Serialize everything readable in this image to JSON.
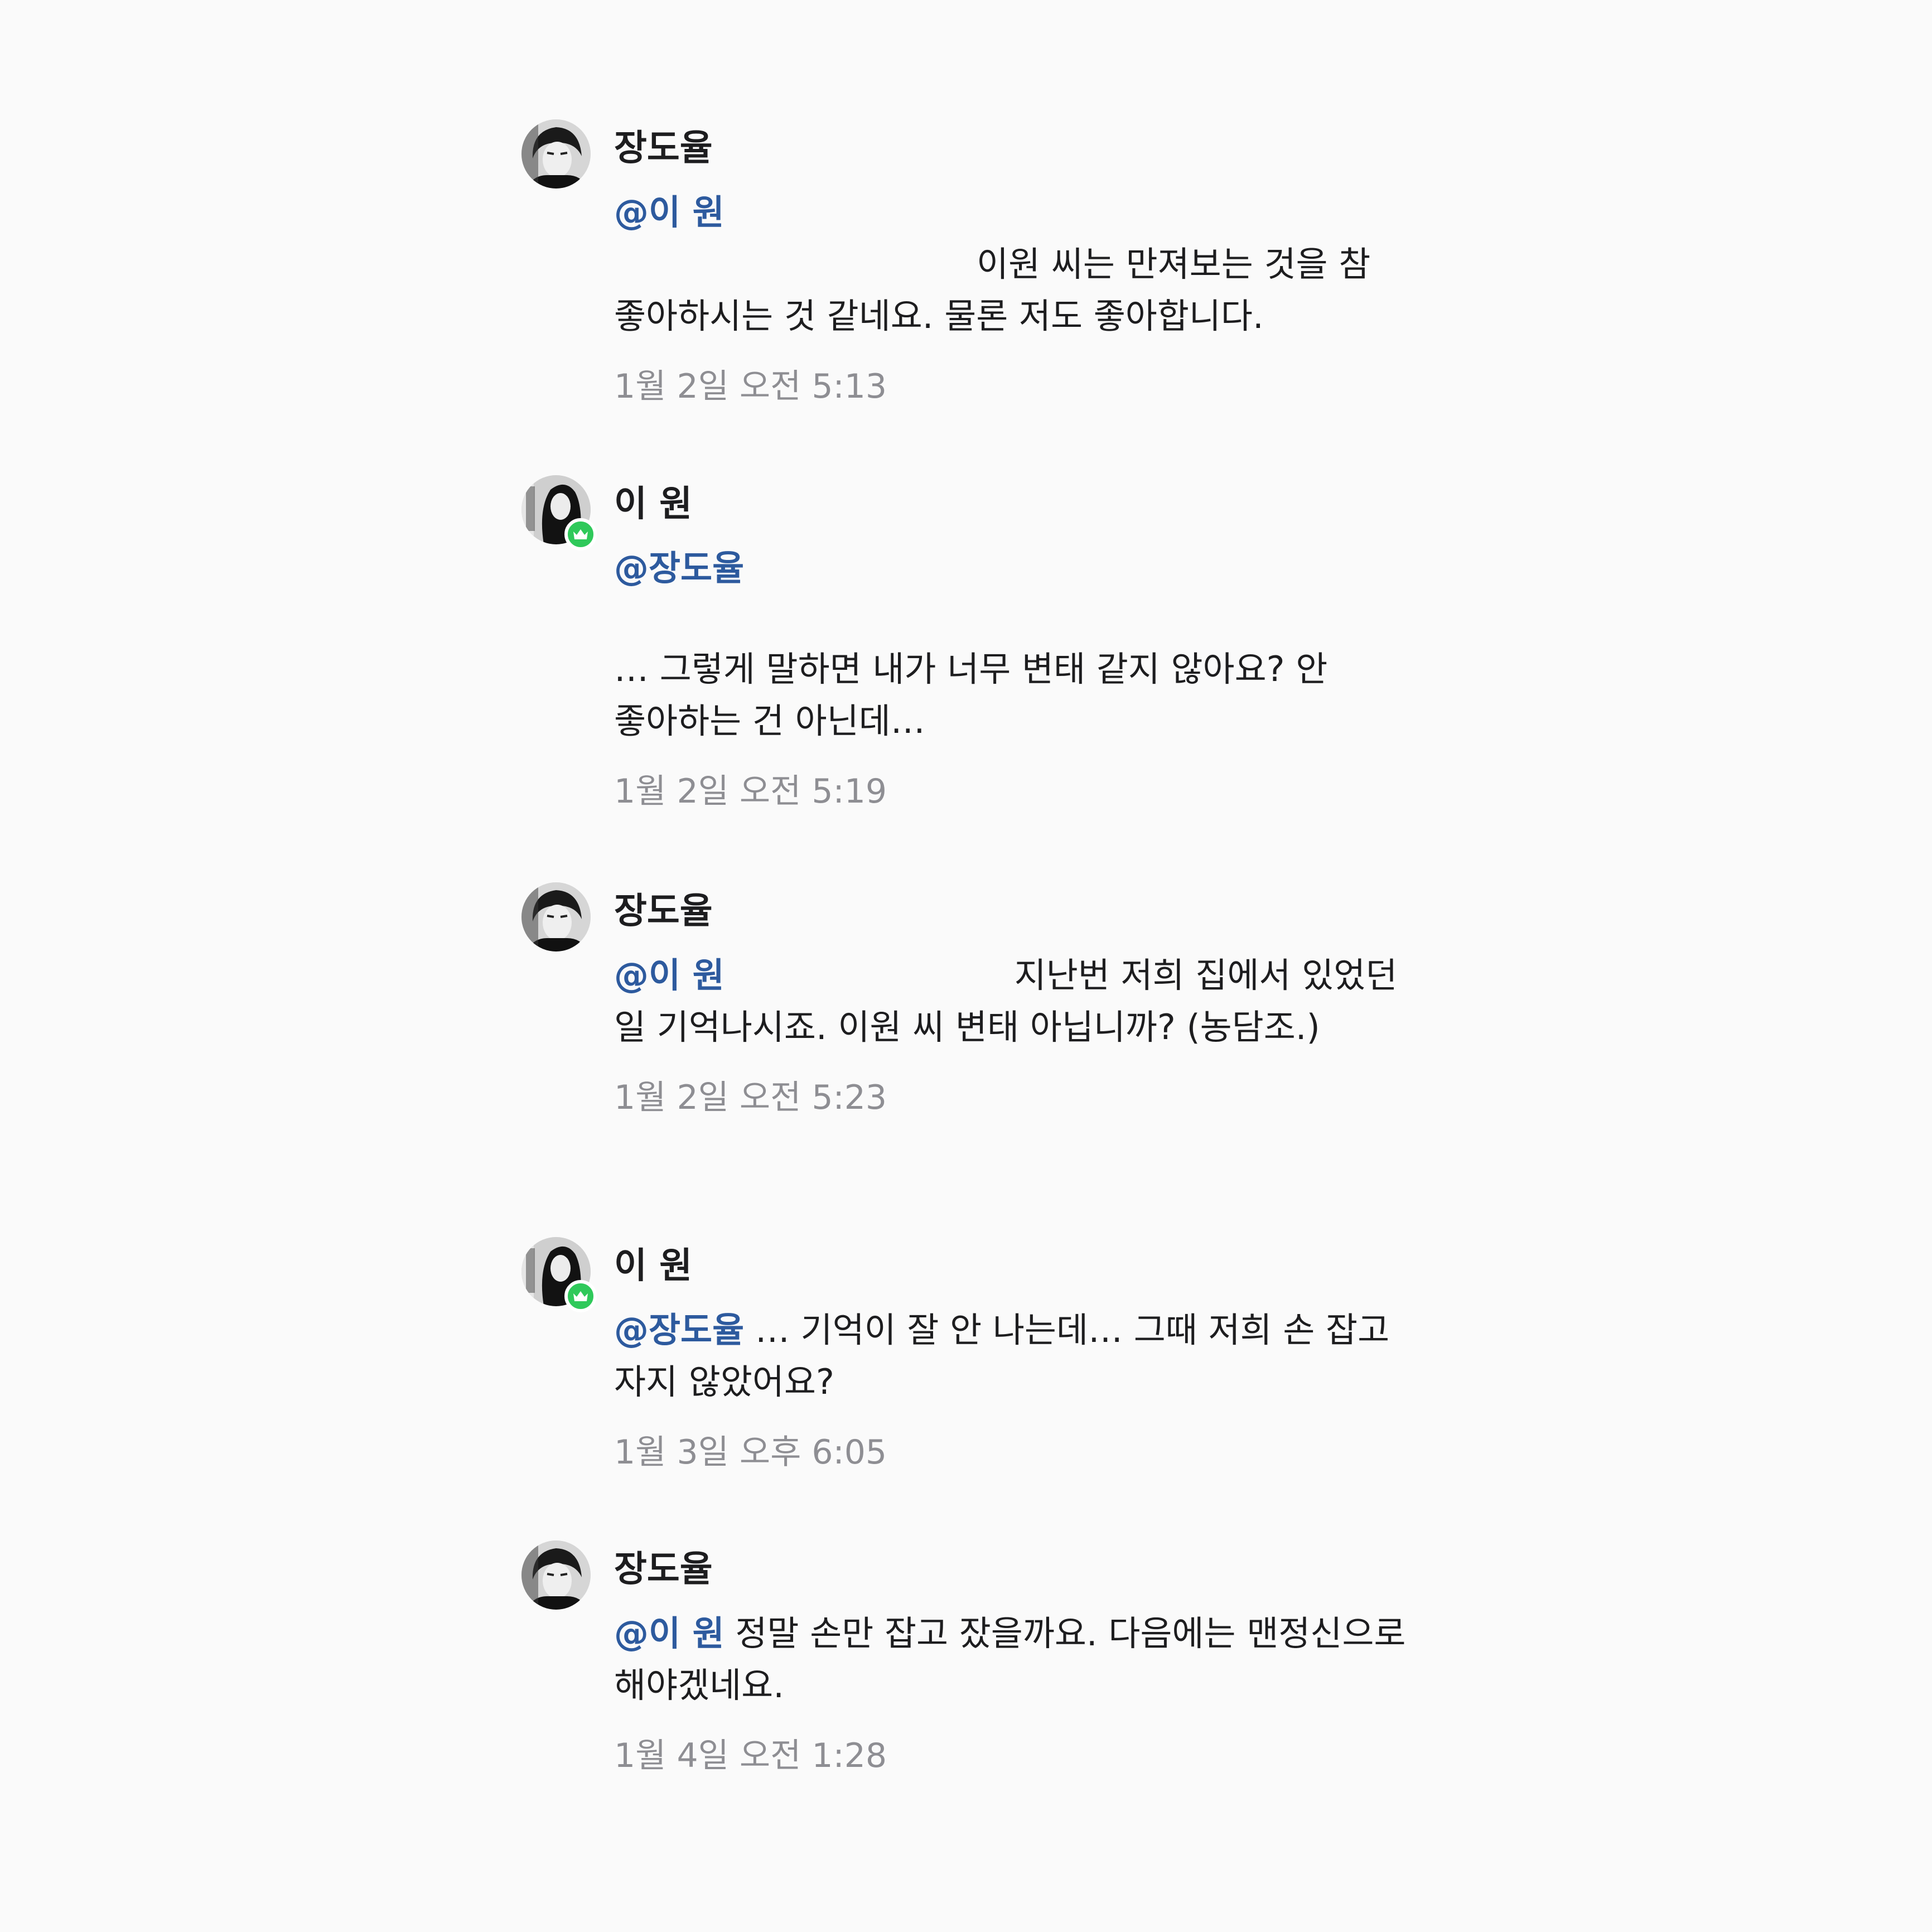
{
  "comments": [
    {
      "author": "장도율",
      "mention": "@이 원",
      "text": "이원 씨는 만져보는 것을 참 좋아하시는 것 같네요. 물론 저도 좋아합니다.",
      "time": "1월 2일 오전 5:13"
    },
    {
      "author": "이 원",
      "mention": "@장도율",
      "text": "… 그렇게 말하면 내가 너무 변태 같지 않아요? 안 좋아하는 건 아닌데…",
      "time": "1월 2일 오전 5:19"
    },
    {
      "author": "장도율",
      "mention": "@이 원",
      "text": "지난번 저희 집에서 있었던 일 기억나시죠. 이원 씨 변태 아닙니까? (농담조.)",
      "time": "1월 2일 오전 5:23"
    },
    {
      "author": "이 원",
      "mention": "@장도율",
      "text": "… 기억이 잘 안 나는데… 그때 저희 손 잡고 자지 않았어요?",
      "time": "1월 3일 오후 6:05"
    },
    {
      "author": "장도율",
      "mention": "@이 원",
      "text": "정말 손만 잡고 잤을까요. 다음에는 맨정신으로 해야겠네요.",
      "time": "1월 4일 오전 1:28"
    }
  ],
  "colors": {
    "background": "#fafafa",
    "mention": "#2d5a9e",
    "timestamp": "#8e8e93",
    "badge": "#2fc95a"
  },
  "icons": {
    "owner_badge": "crown-icon",
    "avatar": "profile-photo"
  }
}
